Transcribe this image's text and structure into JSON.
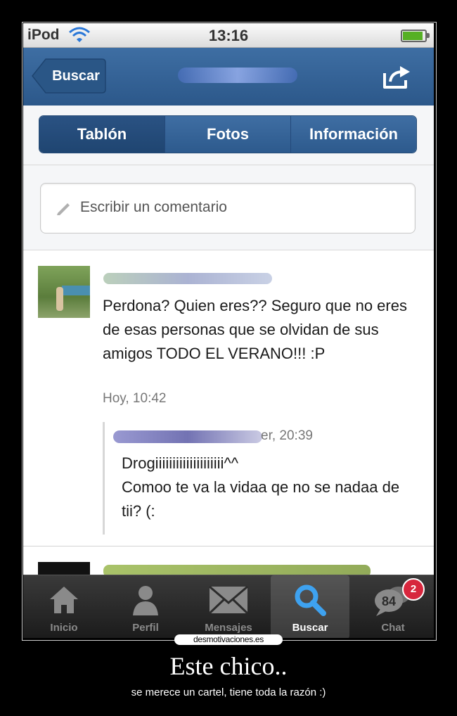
{
  "status_bar": {
    "device": "iPod",
    "time": "13:16"
  },
  "nav": {
    "back_label": "Buscar"
  },
  "tabs": [
    {
      "label": "Tablón"
    },
    {
      "label": "Fotos"
    },
    {
      "label": "Información"
    }
  ],
  "comment": {
    "placeholder": "Escribir un comentario"
  },
  "post": {
    "text": "Perdona? Quien eres?? Seguro que no eres de esas personas que se olvidan de sus amigos TODO EL VERANO!!! :P",
    "time": "Hoy, 10:42",
    "reply": {
      "meta": "er, 20:39",
      "line1": "Drogiiiiiiiiiiiiiiiiiiii^^",
      "line2": "Comoo te va la vidaa qe no se nadaa de tii? (:"
    }
  },
  "tabbar": [
    {
      "label": "Inicio",
      "icon": "home-icon"
    },
    {
      "label": "Perfil",
      "icon": "profile-icon"
    },
    {
      "label": "Mensajes",
      "icon": "mail-icon"
    },
    {
      "label": "Buscar",
      "icon": "search-icon",
      "active": true
    },
    {
      "label": "Chat",
      "icon": "chat-icon",
      "badge": "2",
      "count": "84"
    }
  ],
  "watermark": "desmotivaciones.es",
  "caption": {
    "title": "Este chico..",
    "subtitle": "se merece un cartel, tiene toda la razón :)"
  },
  "colors": {
    "nav_blue": "#2c588a",
    "badge_red": "#d7263d",
    "background": "#000000"
  }
}
